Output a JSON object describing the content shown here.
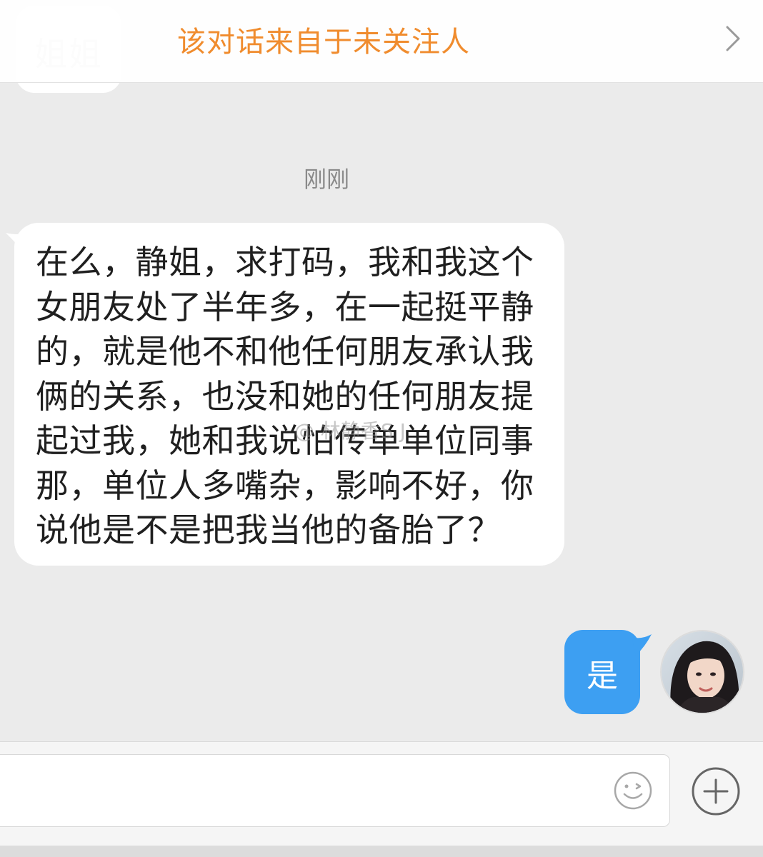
{
  "previous_message": {
    "text": "姐姐"
  },
  "banner": {
    "text": "该对话来自于未关注人",
    "icon": "chevron-right-icon"
  },
  "timestamp": "刚刚",
  "incoming_message": {
    "lines": [
      "在么，静姐，求打码，我和我这个",
      "女朋友处了半年多，在一起挺平静",
      "的，就是他不和他任何朋友承认我",
      "俩的关系，也没和她的任何朋友提",
      "起过我，她和我说怕传单单位同事",
      "那，单位人多嘴杂，影响不好，你",
      "说他是不是把我当他的备胎了？"
    ]
  },
  "watermark": {
    "text": "@ 林静香S J"
  },
  "outgoing_message": {
    "text": "是"
  },
  "input_bar": {
    "value": "",
    "emoji_icon": "smiley-icon",
    "plus_icon": "plus-circle-icon"
  },
  "colors": {
    "banner_text": "#f08c2e",
    "outgoing_bubble": "#3d9ff2",
    "background": "#ebebeb"
  }
}
